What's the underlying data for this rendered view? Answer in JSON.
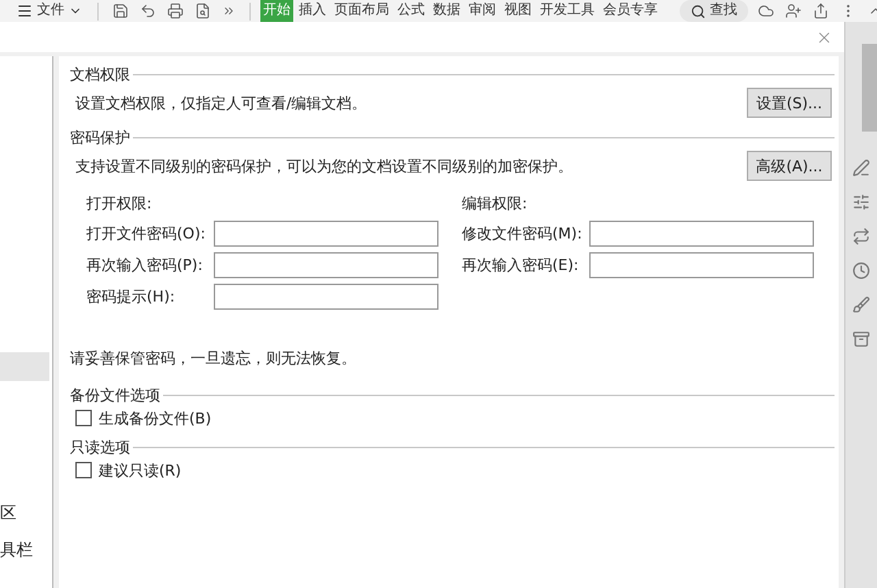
{
  "toolbar": {
    "menu": "文件",
    "tabs": [
      {
        "label": "开始",
        "selected": true
      },
      {
        "label": "插入",
        "selected": false
      },
      {
        "label": "页面布局",
        "selected": false
      },
      {
        "label": "公式",
        "selected": false
      },
      {
        "label": "数据",
        "selected": false
      },
      {
        "label": "审阅",
        "selected": false
      },
      {
        "label": "视图",
        "selected": false
      },
      {
        "label": "开发工具",
        "selected": false
      },
      {
        "label": "会员专享",
        "selected": false
      }
    ],
    "search": "查找"
  },
  "sidebar": {
    "items": [
      {
        "selected": true
      },
      {
        "label": "区",
        "selected": false
      },
      {
        "label": "具栏",
        "selected": false
      }
    ]
  },
  "dialog": {
    "document_permission": {
      "title": "文档权限",
      "description": "设置文档权限，仅指定人可查看/编辑文档。",
      "button": "设置(S)..."
    },
    "password_protection": {
      "title": "密码保护",
      "description": "支持设置不同级别的密码保护，可以为您的文档设置不同级别的加密保护。",
      "button": "高级(A)...",
      "groups": [
        {
          "heading": "打开权限:",
          "fields": [
            {
              "label": "打开文件密码(O):"
            },
            {
              "label": "再次输入密码(P):"
            },
            {
              "label": "密码提示(H):"
            }
          ]
        },
        {
          "heading": "编辑权限:",
          "fields": [
            {
              "label": "修改文件密码(M):"
            },
            {
              "label": "再次输入密码(E):"
            }
          ]
        }
      ]
    },
    "note": "请妥善保管密码，一旦遗忘，则无法恢复。",
    "options": [
      {
        "title": "备份文件选项",
        "checkbox": {
          "label": "生成备份文件(B)",
          "checked": false
        }
      },
      {
        "title": "只读选项",
        "checkbox": {
          "label": "建议只读(R)",
          "checked": false
        }
      }
    ]
  }
}
